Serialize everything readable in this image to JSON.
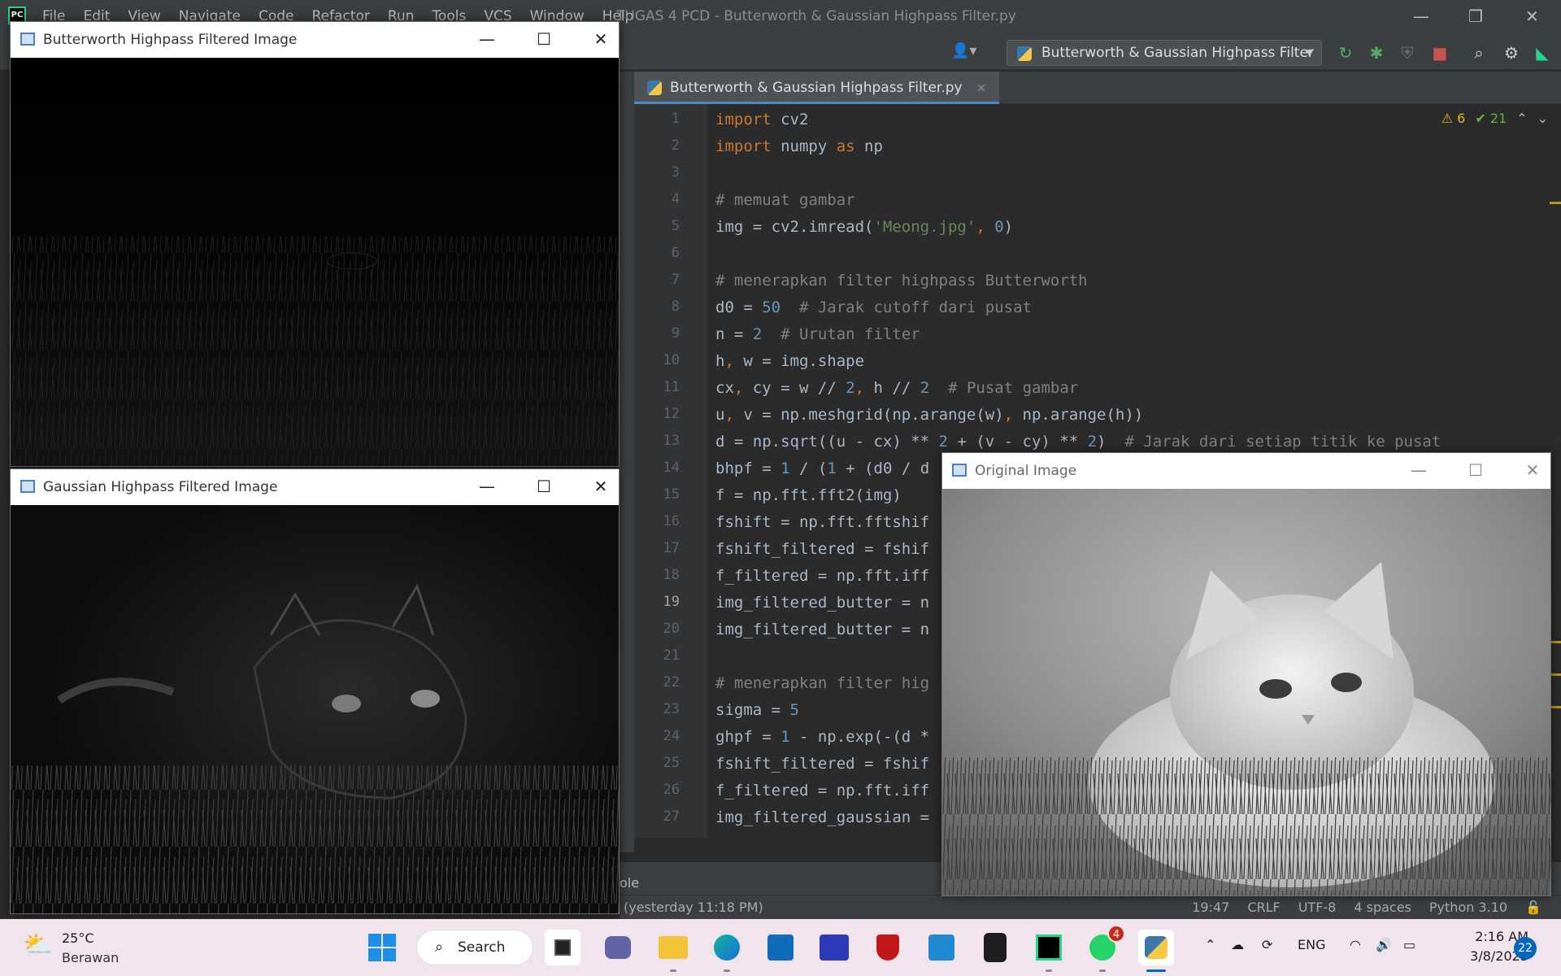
{
  "ide": {
    "menu": [
      "File",
      "Edit",
      "View",
      "Navigate",
      "Code",
      "Refactor",
      "Run",
      "Tools",
      "VCS",
      "Window",
      "Help"
    ],
    "window_title": "TUGAS 4 PCD - Butterworth & Gaussian Highpass Filter.py",
    "logo_text": "PC",
    "run_config": "Butterworth & Gaussian Highpass Filter",
    "active_tab": "Butterworth & Gaussian Highpass Filter.py",
    "inspections": {
      "warnings": "6",
      "ok": "21"
    },
    "current_line": 19,
    "code_lines": [
      {
        "n": 1,
        "text": "import cv2"
      },
      {
        "n": 2,
        "text": "import numpy as np"
      },
      {
        "n": 3,
        "text": ""
      },
      {
        "n": 4,
        "text": "# memuat gambar"
      },
      {
        "n": 5,
        "text": "img = cv2.imread('Meong.jpg', 0)"
      },
      {
        "n": 6,
        "text": ""
      },
      {
        "n": 7,
        "text": "# menerapkan filter highpass Butterworth"
      },
      {
        "n": 8,
        "text": "d0 = 50  # Jarak cutoff dari pusat"
      },
      {
        "n": 9,
        "text": "n = 2  # Urutan filter"
      },
      {
        "n": 10,
        "text": "h, w = img.shape"
      },
      {
        "n": 11,
        "text": "cx, cy = w // 2, h // 2  # Pusat gambar"
      },
      {
        "n": 12,
        "text": "u, v = np.meshgrid(np.arange(w), np.arange(h))"
      },
      {
        "n": 13,
        "text": "d = np.sqrt((u - cx) ** 2 + (v - cy) ** 2)  # Jarak dari setiap titik ke pusat"
      },
      {
        "n": 14,
        "text": "bhpf = 1 / (1 + (d0 / d"
      },
      {
        "n": 15,
        "text": "f = np.fft.fft2(img)"
      },
      {
        "n": 16,
        "text": "fshift = np.fft.fftshif"
      },
      {
        "n": 17,
        "text": "fshift_filtered = fshif"
      },
      {
        "n": 18,
        "text": "f_filtered = np.fft.iff"
      },
      {
        "n": 19,
        "text": "img_filtered_butter = n"
      },
      {
        "n": 20,
        "text": "img_filtered_butter = n"
      },
      {
        "n": 21,
        "text": ""
      },
      {
        "n": 22,
        "text": "# menerapkan filter hig"
      },
      {
        "n": 23,
        "text": "sigma = 5"
      },
      {
        "n": 24,
        "text": "ghpf = 1 - np.exp(-(d *"
      },
      {
        "n": 25,
        "text": "fshift_filtered = fshif"
      },
      {
        "n": 26,
        "text": "f_filtered = np.fft.iff"
      },
      {
        "n": 27,
        "text": "img_filtered_gaussian ="
      }
    ],
    "bottom_panel_label": "ole",
    "status_left": "(yesterday 11:18 PM)",
    "status_right": [
      "19:47",
      "CRLF",
      "UTF-8",
      "4 spaces",
      "Python 3.10"
    ]
  },
  "windows": {
    "butterworth": {
      "title": "Butterworth Highpass Filtered Image"
    },
    "gaussian": {
      "title": "Gaussian Highpass Filtered Image"
    },
    "original": {
      "title": "Original Image"
    }
  },
  "taskbar": {
    "weather": {
      "temp": "25°C",
      "condition": "Berawan"
    },
    "search_label": "Search",
    "whatsapp_badge": "4",
    "language": "ENG",
    "time": "2:16 AM",
    "date": "3/8/2023",
    "notification_count": "22"
  },
  "colors": {
    "ide_bg": "#2b2b2b",
    "keyword": "#cc7832",
    "comment": "#808080",
    "string": "#6a8759",
    "number": "#6897bb",
    "taskbar_bg": "#f1e4ec",
    "accent": "#0067c0"
  }
}
